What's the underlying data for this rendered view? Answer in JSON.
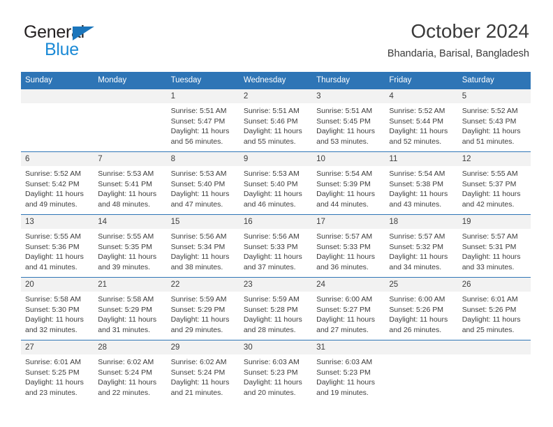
{
  "logo": {
    "word_one": "General",
    "word_two": "Blue",
    "triangle_icon": "triangle-icon",
    "brand_dark": "#231f20",
    "brand_blue": "#1b8ad6"
  },
  "header": {
    "title": "October 2024",
    "subtitle": "Bhandaria, Barisal, Bangladesh"
  },
  "theme": {
    "header_blue": "#2e75b6",
    "daynum_band": "#f2f2f2",
    "text": "#3c3c3c"
  },
  "calendar": {
    "weekday_headers": [
      "Sunday",
      "Monday",
      "Tuesday",
      "Wednesday",
      "Thursday",
      "Friday",
      "Saturday"
    ],
    "labels": {
      "sunrise": "Sunrise:",
      "sunset": "Sunset:",
      "daylight": "Daylight:"
    },
    "weeks": [
      [
        {
          "day": "",
          "sunrise": "",
          "sunset": "",
          "daylight": ""
        },
        {
          "day": "",
          "sunrise": "",
          "sunset": "",
          "daylight": ""
        },
        {
          "day": "1",
          "sunrise": "Sunrise: 5:51 AM",
          "sunset": "Sunset: 5:47 PM",
          "daylight": "Daylight: 11 hours and 56 minutes."
        },
        {
          "day": "2",
          "sunrise": "Sunrise: 5:51 AM",
          "sunset": "Sunset: 5:46 PM",
          "daylight": "Daylight: 11 hours and 55 minutes."
        },
        {
          "day": "3",
          "sunrise": "Sunrise: 5:51 AM",
          "sunset": "Sunset: 5:45 PM",
          "daylight": "Daylight: 11 hours and 53 minutes."
        },
        {
          "day": "4",
          "sunrise": "Sunrise: 5:52 AM",
          "sunset": "Sunset: 5:44 PM",
          "daylight": "Daylight: 11 hours and 52 minutes."
        },
        {
          "day": "5",
          "sunrise": "Sunrise: 5:52 AM",
          "sunset": "Sunset: 5:43 PM",
          "daylight": "Daylight: 11 hours and 51 minutes."
        }
      ],
      [
        {
          "day": "6",
          "sunrise": "Sunrise: 5:52 AM",
          "sunset": "Sunset: 5:42 PM",
          "daylight": "Daylight: 11 hours and 49 minutes."
        },
        {
          "day": "7",
          "sunrise": "Sunrise: 5:53 AM",
          "sunset": "Sunset: 5:41 PM",
          "daylight": "Daylight: 11 hours and 48 minutes."
        },
        {
          "day": "8",
          "sunrise": "Sunrise: 5:53 AM",
          "sunset": "Sunset: 5:40 PM",
          "daylight": "Daylight: 11 hours and 47 minutes."
        },
        {
          "day": "9",
          "sunrise": "Sunrise: 5:53 AM",
          "sunset": "Sunset: 5:40 PM",
          "daylight": "Daylight: 11 hours and 46 minutes."
        },
        {
          "day": "10",
          "sunrise": "Sunrise: 5:54 AM",
          "sunset": "Sunset: 5:39 PM",
          "daylight": "Daylight: 11 hours and 44 minutes."
        },
        {
          "day": "11",
          "sunrise": "Sunrise: 5:54 AM",
          "sunset": "Sunset: 5:38 PM",
          "daylight": "Daylight: 11 hours and 43 minutes."
        },
        {
          "day": "12",
          "sunrise": "Sunrise: 5:55 AM",
          "sunset": "Sunset: 5:37 PM",
          "daylight": "Daylight: 11 hours and 42 minutes."
        }
      ],
      [
        {
          "day": "13",
          "sunrise": "Sunrise: 5:55 AM",
          "sunset": "Sunset: 5:36 PM",
          "daylight": "Daylight: 11 hours and 41 minutes."
        },
        {
          "day": "14",
          "sunrise": "Sunrise: 5:55 AM",
          "sunset": "Sunset: 5:35 PM",
          "daylight": "Daylight: 11 hours and 39 minutes."
        },
        {
          "day": "15",
          "sunrise": "Sunrise: 5:56 AM",
          "sunset": "Sunset: 5:34 PM",
          "daylight": "Daylight: 11 hours and 38 minutes."
        },
        {
          "day": "16",
          "sunrise": "Sunrise: 5:56 AM",
          "sunset": "Sunset: 5:33 PM",
          "daylight": "Daylight: 11 hours and 37 minutes."
        },
        {
          "day": "17",
          "sunrise": "Sunrise: 5:57 AM",
          "sunset": "Sunset: 5:33 PM",
          "daylight": "Daylight: 11 hours and 36 minutes."
        },
        {
          "day": "18",
          "sunrise": "Sunrise: 5:57 AM",
          "sunset": "Sunset: 5:32 PM",
          "daylight": "Daylight: 11 hours and 34 minutes."
        },
        {
          "day": "19",
          "sunrise": "Sunrise: 5:57 AM",
          "sunset": "Sunset: 5:31 PM",
          "daylight": "Daylight: 11 hours and 33 minutes."
        }
      ],
      [
        {
          "day": "20",
          "sunrise": "Sunrise: 5:58 AM",
          "sunset": "Sunset: 5:30 PM",
          "daylight": "Daylight: 11 hours and 32 minutes."
        },
        {
          "day": "21",
          "sunrise": "Sunrise: 5:58 AM",
          "sunset": "Sunset: 5:29 PM",
          "daylight": "Daylight: 11 hours and 31 minutes."
        },
        {
          "day": "22",
          "sunrise": "Sunrise: 5:59 AM",
          "sunset": "Sunset: 5:29 PM",
          "daylight": "Daylight: 11 hours and 29 minutes."
        },
        {
          "day": "23",
          "sunrise": "Sunrise: 5:59 AM",
          "sunset": "Sunset: 5:28 PM",
          "daylight": "Daylight: 11 hours and 28 minutes."
        },
        {
          "day": "24",
          "sunrise": "Sunrise: 6:00 AM",
          "sunset": "Sunset: 5:27 PM",
          "daylight": "Daylight: 11 hours and 27 minutes."
        },
        {
          "day": "25",
          "sunrise": "Sunrise: 6:00 AM",
          "sunset": "Sunset: 5:26 PM",
          "daylight": "Daylight: 11 hours and 26 minutes."
        },
        {
          "day": "26",
          "sunrise": "Sunrise: 6:01 AM",
          "sunset": "Sunset: 5:26 PM",
          "daylight": "Daylight: 11 hours and 25 minutes."
        }
      ],
      [
        {
          "day": "27",
          "sunrise": "Sunrise: 6:01 AM",
          "sunset": "Sunset: 5:25 PM",
          "daylight": "Daylight: 11 hours and 23 minutes."
        },
        {
          "day": "28",
          "sunrise": "Sunrise: 6:02 AM",
          "sunset": "Sunset: 5:24 PM",
          "daylight": "Daylight: 11 hours and 22 minutes."
        },
        {
          "day": "29",
          "sunrise": "Sunrise: 6:02 AM",
          "sunset": "Sunset: 5:24 PM",
          "daylight": "Daylight: 11 hours and 21 minutes."
        },
        {
          "day": "30",
          "sunrise": "Sunrise: 6:03 AM",
          "sunset": "Sunset: 5:23 PM",
          "daylight": "Daylight: 11 hours and 20 minutes."
        },
        {
          "day": "31",
          "sunrise": "Sunrise: 6:03 AM",
          "sunset": "Sunset: 5:23 PM",
          "daylight": "Daylight: 11 hours and 19 minutes."
        },
        {
          "day": "",
          "sunrise": "",
          "sunset": "",
          "daylight": ""
        },
        {
          "day": "",
          "sunrise": "",
          "sunset": "",
          "daylight": ""
        }
      ]
    ]
  }
}
